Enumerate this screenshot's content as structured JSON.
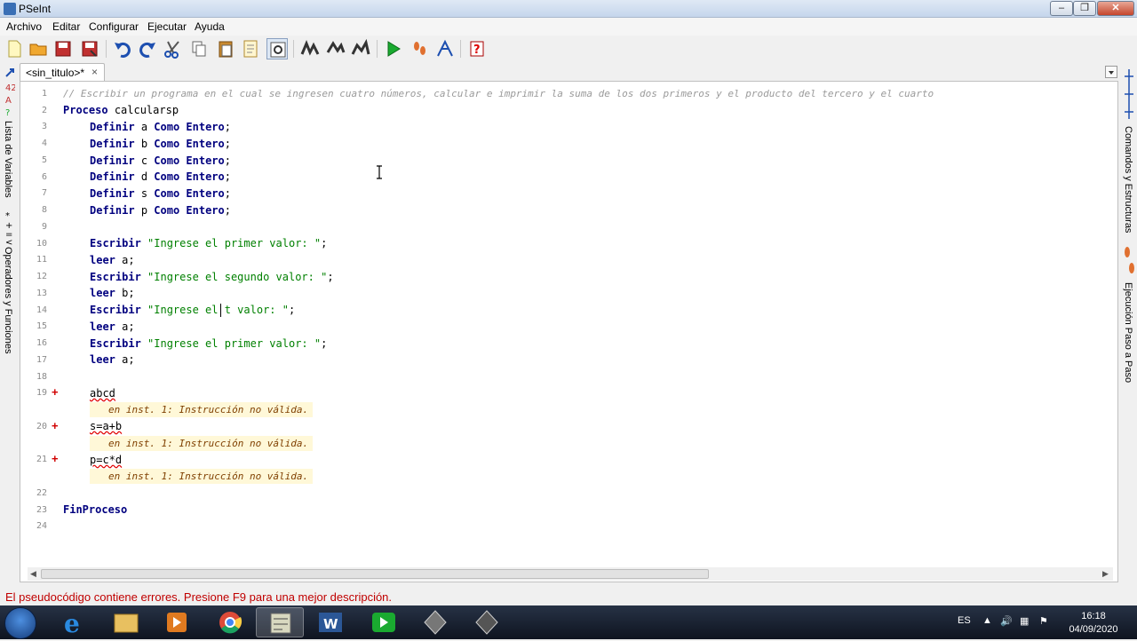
{
  "window": {
    "title": "PSeInt"
  },
  "menu": [
    "Archivo",
    "Editar",
    "Configurar",
    "Ejecutar",
    "Ayuda"
  ],
  "tab": {
    "label": "<sin_titulo>*",
    "close": "×"
  },
  "panels": {
    "left": [
      "Lista de Variables",
      "Operadores y Funciones"
    ],
    "right": [
      "Comandos y Estructuras",
      "Ejecución Paso a Paso"
    ]
  },
  "editor": {
    "line_numbers": [
      "1",
      "2",
      "3",
      "4",
      "5",
      "6",
      "7",
      "8",
      "9",
      "10",
      "11",
      "12",
      "13",
      "14",
      "15",
      "16",
      "17",
      "18",
      "19",
      "20",
      "21",
      "22",
      "23",
      "24"
    ],
    "comment": "// Escribir un programa en el cual se ingresen cuatro números, calcular e imprimir la suma de los dos primeros y el producto del tercero y el cuarto",
    "proceso_kw": "Proceso",
    "proceso_name": "calcularsp",
    "definir_kw": "Definir",
    "como_kw": "Como Entero",
    "definitions": [
      "a",
      "b",
      "c",
      "d",
      "s",
      "p"
    ],
    "escribir_kw": "Escribir",
    "leer_kw": "leer",
    "io_lines": [
      {
        "cmd": "Escribir",
        "arg": "\"Ingrese el primer valor: \""
      },
      {
        "cmd": "leer",
        "arg": "a"
      },
      {
        "cmd": "Escribir",
        "arg": "\"Ingrese el segundo valor: \""
      },
      {
        "cmd": "leer",
        "arg": "b"
      },
      {
        "cmd": "Escribir",
        "arg": "\"Ingrese el t valor: \""
      },
      {
        "cmd": "leer",
        "arg": "a"
      },
      {
        "cmd": "Escribir",
        "arg": "\"Ingrese el primer valor: \""
      },
      {
        "cmd": "leer",
        "arg": "a"
      }
    ],
    "error_lines": [
      "abcd",
      "s=a+b",
      "p=c*d"
    ],
    "error_marker": "+",
    "error_message": "en inst. 1: Instrucción no válida.",
    "end_kw": "FinProceso"
  },
  "status": {
    "message": "El pseudocódigo contiene errores. Presione F9 para una mejor descripción."
  },
  "taskbar": {
    "language": "ES",
    "time": "16:18",
    "date": "04/09/2020"
  }
}
